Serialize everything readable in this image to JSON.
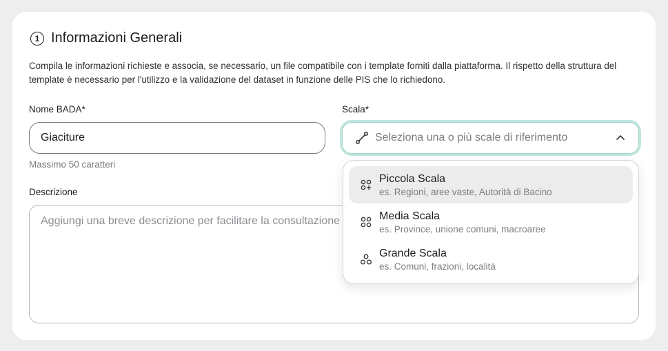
{
  "section": {
    "step_number": "1",
    "title": "Informazioni Generali",
    "intro": "Compila le informazioni richieste e associa, se necessario, un file compatibile con i template forniti dalla piattaforma. Il rispetto della struttura del template è necessario per l'utilizzo e la validazione del dataset in funzione delle PIS che lo richiedono."
  },
  "form": {
    "name": {
      "label": "Nome BADA*",
      "value": "Giaciture",
      "helper": "Massimo 50 caratteri"
    },
    "scale": {
      "label": "Scala*",
      "placeholder": "Seleziona una o più scale di riferimento",
      "icon": "ruler-icon",
      "expanded": true,
      "options": [
        {
          "title": "Piccola Scala",
          "subtitle": "es. Regioni, aree vaste, Autorità di Bacino",
          "icon": "small-scale-icon",
          "highlighted": true
        },
        {
          "title": "Media Scala",
          "subtitle": "es. Province, unione comuni, macroaree",
          "icon": "medium-scale-icon",
          "highlighted": false
        },
        {
          "title": "Grande Scala",
          "subtitle": "es. Comuni, frazioni, località",
          "icon": "large-scale-icon",
          "highlighted": false
        }
      ]
    },
    "description": {
      "label": "Descrizione",
      "placeholder": "Aggiungi una breve descrizione per facilitare la consultazione"
    }
  },
  "colors": {
    "focus_ring": "#bfe6de",
    "highlight_bg": "#ececec",
    "text": "#1d1d21",
    "muted": "#7c7c82"
  }
}
